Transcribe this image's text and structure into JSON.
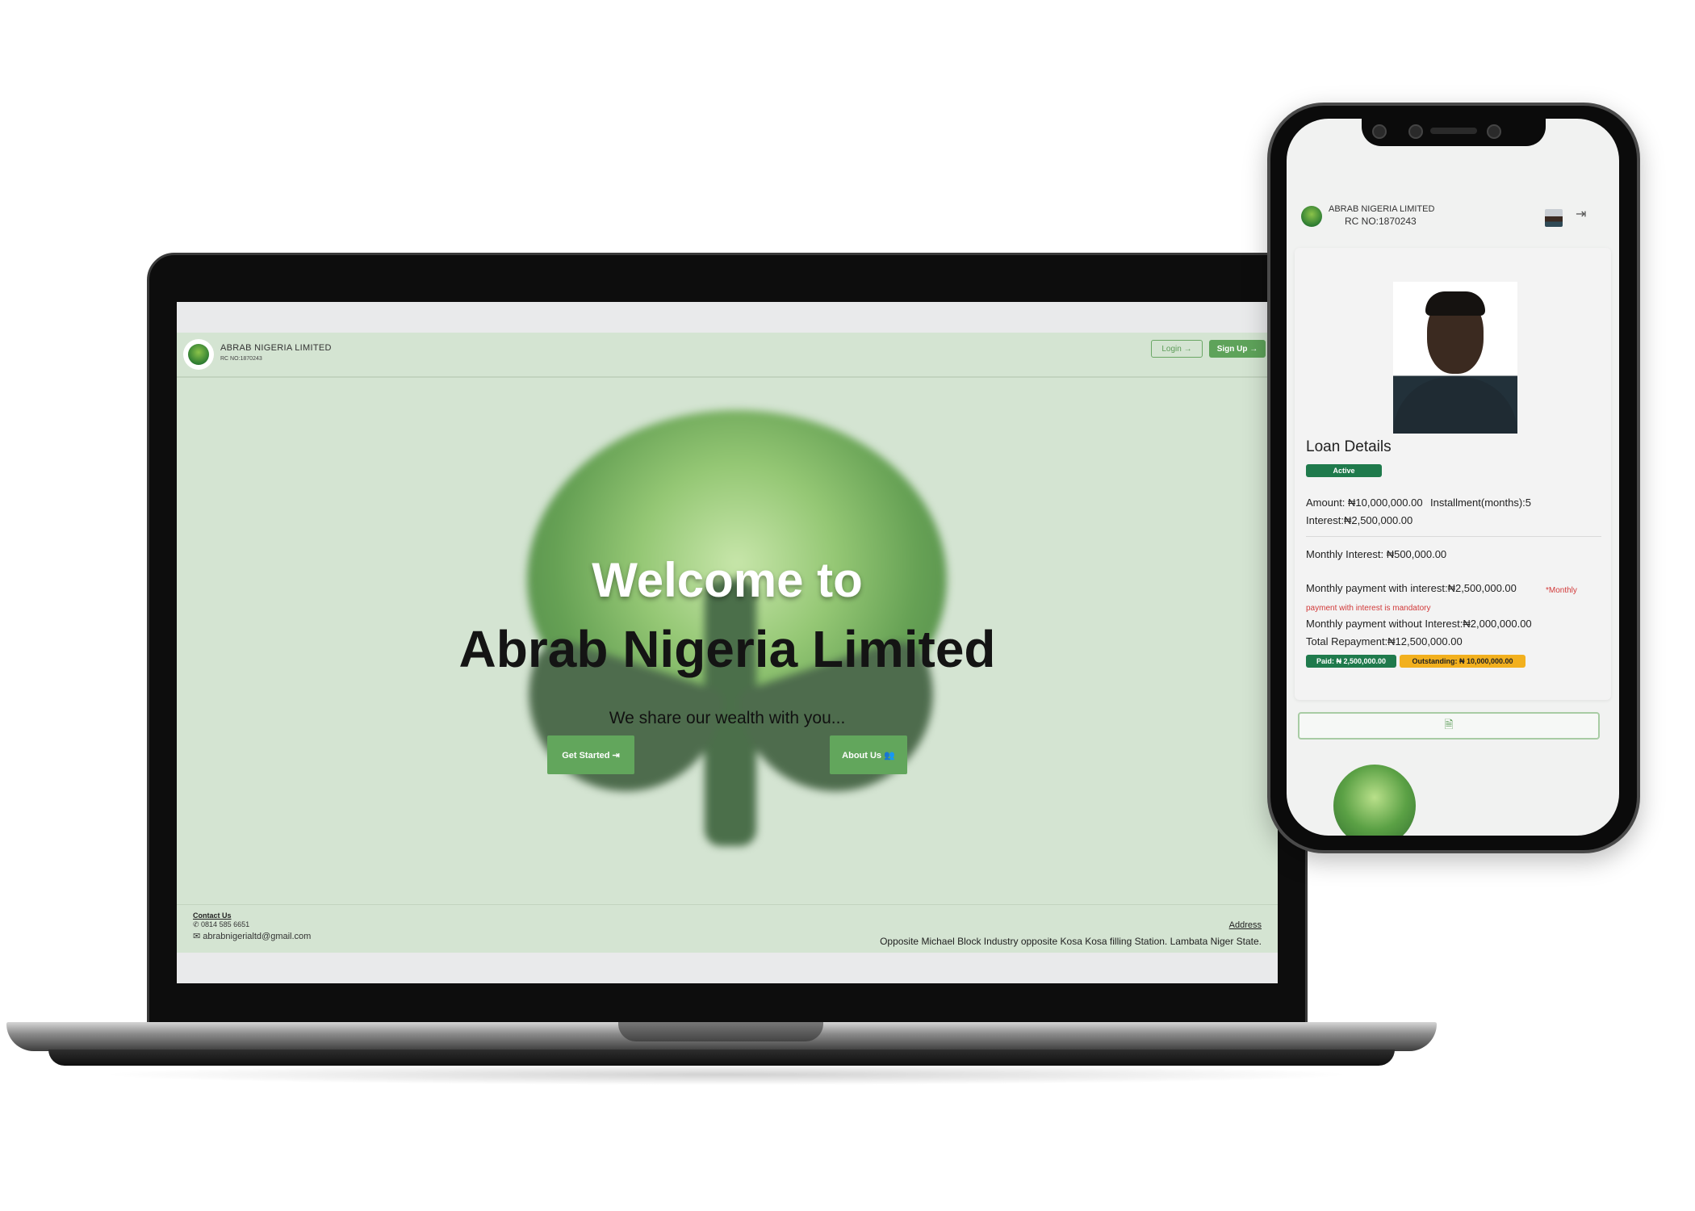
{
  "laptop_site": {
    "brand": {
      "name": "ABRAB NIGERIA LIMITED",
      "rc": "RC NO:1870243"
    },
    "nav": {
      "login": "Login →",
      "signup": "Sign Up →"
    },
    "hero": {
      "welcome": "Welcome to",
      "company": "Abrab Nigeria Limited",
      "tagline": "We share our wealth with you...",
      "get_started": "Get Started ⇥",
      "about_us": "About Us 👥"
    },
    "footer": {
      "contact_title": "Contact Us",
      "phone": "✆ 0814 585 6651",
      "email": "✉ abrabnigerialtd@gmail.com",
      "address_title": "Address",
      "address": "Opposite Michael Block Industry opposite Kosa Kosa filling Station. Lambata Niger State."
    }
  },
  "phone_app": {
    "brand": {
      "name": "ABRAB NIGERIA LIMITED",
      "rc": "RC NO:1870243"
    },
    "logout_icon": "⇥",
    "loan": {
      "title": "Loan Details",
      "status": "Active",
      "amount": "Amount: ₦10,000,000.00",
      "installment": "Installment(months):5",
      "interest": "Interest:₦2,500,000.00",
      "monthly_interest": "Monthly Interest: ₦500,000.00",
      "monthly_with_interest": "Monthly payment with interest:₦2,500,000.00",
      "mandatory_note": "*Monthly payment with interest is mandatory",
      "monthly_without_interest": "Monthly payment without Interest:₦2,000,000.00",
      "total_repayment": "Total Repayment:₦12,500,000.00",
      "paid": "Paid: ₦ 2,500,000.00",
      "outstanding": "Outstanding: ₦ 10,000,000.00"
    },
    "document_icon": "🗎"
  },
  "colors": {
    "site_bg": "#d4e4d2",
    "brand_green": "#5ea35a",
    "active_green": "#1f7a4c",
    "outstanding_yellow": "#f2b01e",
    "note_red": "#d23a3a"
  }
}
